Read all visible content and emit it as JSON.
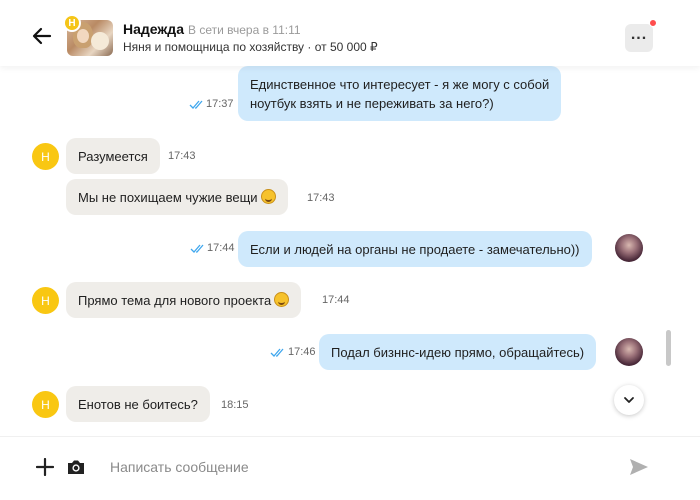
{
  "header": {
    "contact_name": "Надежда",
    "status": "В сети вчера в 11:11",
    "subtitle": "Няня и помощница по хозяйству · от 50 000 ₽",
    "avatar_badge": "Н"
  },
  "icons": {
    "back": "arrow-left-icon",
    "menu": "more-horizontal-icon",
    "scroll_down": "chevron-down-icon",
    "add": "plus-icon",
    "camera": "camera-icon",
    "send": "send-icon",
    "read": "double-check-icon",
    "emoji": "rolling-on-floor-laughing-emoji"
  },
  "colors": {
    "incoming_bubble": "#efede9",
    "outgoing_bubble": "#cfe9fc",
    "avatar_yellow": "#f9c712",
    "read_ticks": "#3fa7ee",
    "notification_dot": "#ff4d4d"
  },
  "messages": [
    {
      "direction": "out",
      "line1": "Единственное что интересует - я же могу с собой",
      "line2": "ноутбук взять и не переживать за него?)",
      "time": "17:37",
      "read": true
    },
    {
      "direction": "in",
      "text": "Разумеется",
      "time": "17:43",
      "avatar": "Н"
    },
    {
      "direction": "in",
      "text": "Мы не похищаем чужие вещи",
      "time": "17:43",
      "emoji": true
    },
    {
      "direction": "out",
      "text": "Если и людей на органы не продаете - замечательно))",
      "time": "17:44",
      "read": true
    },
    {
      "direction": "in",
      "text": "Прямо тема для нового проекта",
      "time": "17:44",
      "avatar": "Н",
      "emoji": true
    },
    {
      "direction": "out",
      "text": "Подал бизннс-идею прямо, обращайтесь)",
      "time": "17:46",
      "read": true
    },
    {
      "direction": "in",
      "text": "Енотов не боитесь?",
      "time": "18:15",
      "avatar": "Н"
    }
  ],
  "composer": {
    "placeholder": "Написать сообщение"
  }
}
